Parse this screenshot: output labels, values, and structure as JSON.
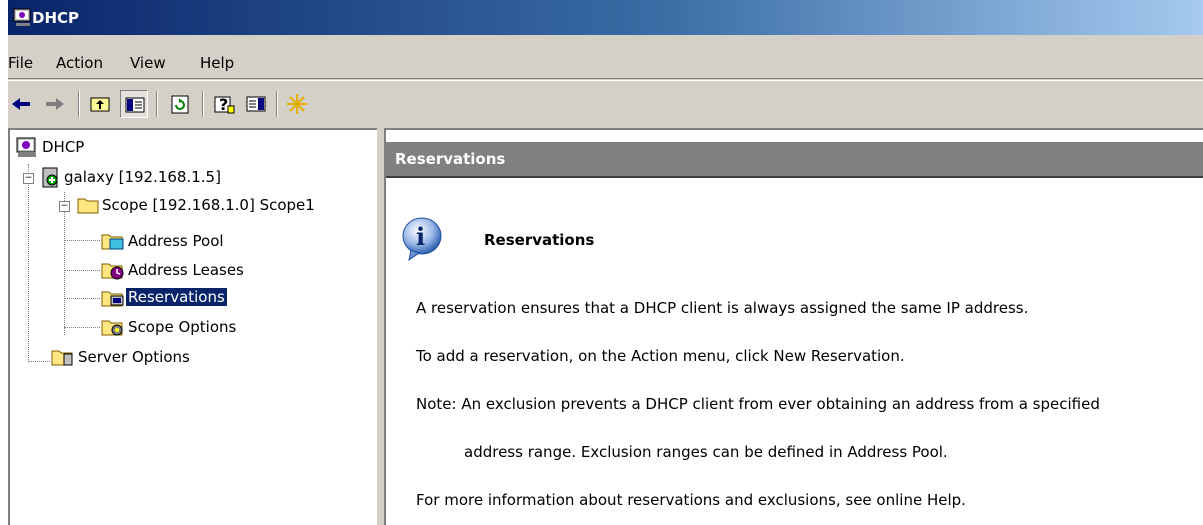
{
  "window": {
    "title": "DHCP"
  },
  "menu": {
    "file": "File",
    "action": "Action",
    "view": "View",
    "help": "Help"
  },
  "toolbar": {
    "buttons": [
      "back-arrow-icon",
      "forward-arrow-icon",
      "up-one-level-icon",
      "show-hide-console-tree-icon",
      "refresh-icon",
      "help-icon",
      "show-hide-action-pane-icon",
      "dhcp-star-icon"
    ]
  },
  "tree": {
    "root": "DHCP",
    "server": "galaxy [192.168.1.5]",
    "scope": "Scope [192.168.1.0] Scope1",
    "address_pool": "Address Pool",
    "address_leases": "Address Leases",
    "reservations": "Reservations",
    "scope_options": "Scope Options",
    "server_options": "Server Options"
  },
  "content": {
    "header": "Reservations",
    "title": "Reservations",
    "para1": "A reservation ensures that a DHCP client is always assigned the same IP address.",
    "para2": "To add a reservation, on the Action menu, click New Reservation.",
    "note_line1": "Note: An exclusion prevents a DHCP client from ever obtaining an address from a specified",
    "note_line2": "address range.  Exclusion ranges can be defined in Address Pool.",
    "para4": "For more information about reservations and exclusions, see online Help."
  },
  "colors": {
    "title_gradient_start": "#0a246a",
    "title_gradient_end": "#a6caf0",
    "face": "#d4d0c8",
    "header_gray": "#808080",
    "selection": "#0a246a"
  }
}
